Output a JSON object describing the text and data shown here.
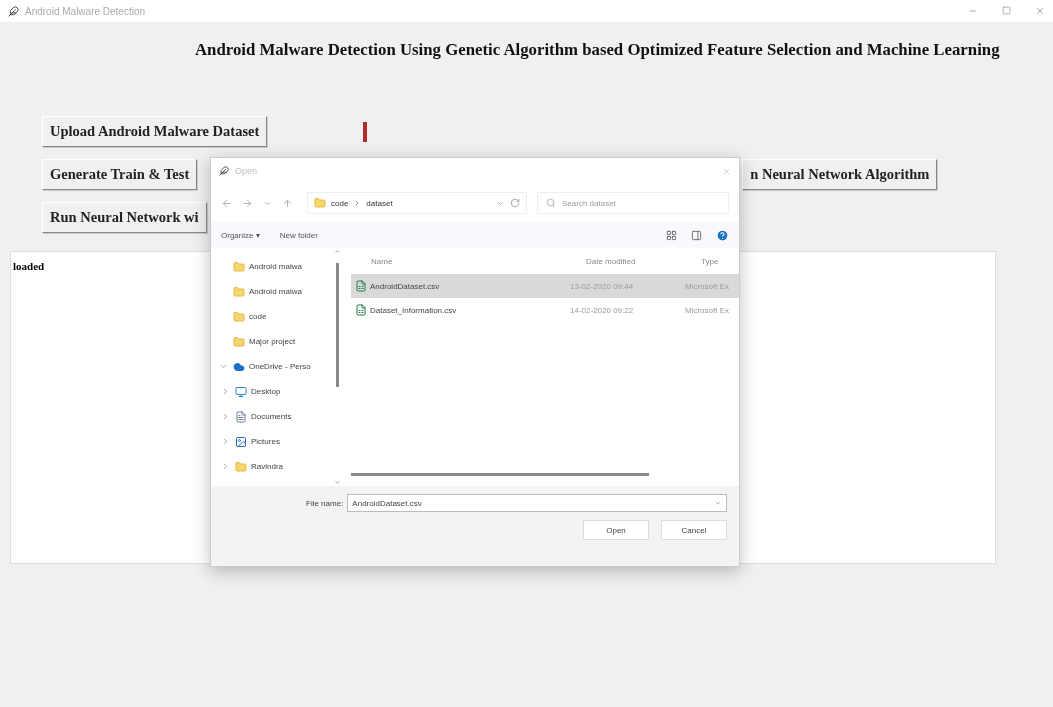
{
  "window": {
    "title": "Android Malware Detection"
  },
  "heading": "Android Malware Detection Using Genetic Algorithm based Optimized Feature Selection and Machine Learning",
  "button_rows": [
    [
      "Upload Android Malware Dataset"
    ],
    [
      "Generate Train & Test",
      "n Neural Network Algorithm"
    ],
    [
      "Run Neural Network wi"
    ]
  ],
  "output": {
    "text": "loaded"
  },
  "dialog": {
    "title": "Open",
    "path": [
      "code",
      "dataset"
    ],
    "search": {
      "placeholder": "Search dataset"
    },
    "toolbar": [
      "Organize ▾",
      "New folder"
    ],
    "nav": [
      {
        "label": "Android malwa",
        "kind": "folder"
      },
      {
        "label": "Android malwa",
        "kind": "folder"
      },
      {
        "label": "code",
        "kind": "folder"
      },
      {
        "label": "Major project",
        "kind": "folder"
      },
      {
        "label": "OneDrive - Perso",
        "kind": "cloud",
        "expanded": true,
        "children": [
          {
            "label": "Desktop",
            "kind": "desktop",
            "expanded": false
          },
          {
            "label": "Documents",
            "kind": "documents",
            "expanded": false
          },
          {
            "label": "Pictures",
            "kind": "pictures",
            "expanded": false
          },
          {
            "label": "Ravindra",
            "kind": "folder",
            "expanded": false
          }
        ]
      }
    ],
    "columns": [
      "Name",
      "Date modified",
      "Type"
    ],
    "files": [
      {
        "name": "AndroidDataset.csv",
        "date": "13-02-2020 09:44",
        "type": "Microsoft Ex",
        "selected": true
      },
      {
        "name": "Dataset_Information.csv",
        "date": "14-02-2020 09:22",
        "type": "Microsoft Ex",
        "selected": false
      }
    ],
    "file_name": {
      "label": "File name:",
      "value": "AndroidDataset.csv"
    },
    "actions": [
      "Open",
      "Cancel"
    ]
  }
}
